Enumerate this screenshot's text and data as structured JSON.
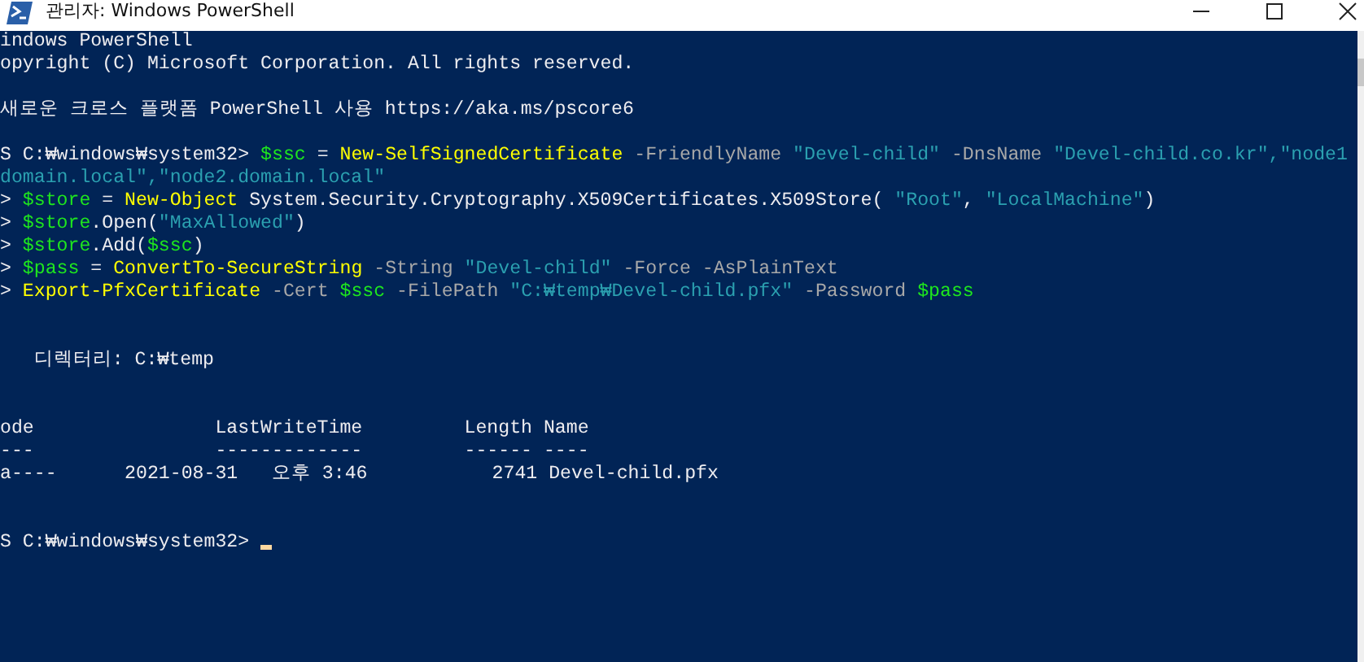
{
  "window": {
    "title": "관리자: Windows PowerShell"
  },
  "console": {
    "lines": [
      {
        "kind": "text",
        "segments": [
          {
            "kind": "plain",
            "text": "indows PowerShell"
          }
        ]
      },
      {
        "kind": "text",
        "segments": [
          {
            "kind": "plain",
            "text": "opyright (C) Microsoft Corporation. All rights reserved."
          }
        ]
      },
      {
        "kind": "blank"
      },
      {
        "kind": "text",
        "segments": [
          {
            "kind": "plain",
            "text": "새로운 크로스 플랫폼 PowerShell 사용 https://aka.ms/pscore6"
          }
        ]
      },
      {
        "kind": "blank"
      },
      {
        "kind": "text",
        "segments": [
          {
            "kind": "plain",
            "text": "S C:₩windows₩system32> "
          },
          {
            "kind": "variable",
            "text": "$ssc"
          },
          {
            "kind": "plain",
            "text": " = "
          },
          {
            "kind": "command",
            "text": "New-SelfSignedCertificate"
          },
          {
            "kind": "parameter",
            "text": " -FriendlyName"
          },
          {
            "kind": "string",
            "text": " \"Devel-child\""
          },
          {
            "kind": "parameter",
            "text": " -DnsName"
          },
          {
            "kind": "string",
            "text": " \"Devel-child.co.kr\",\"node1"
          }
        ]
      },
      {
        "kind": "text",
        "segments": [
          {
            "kind": "string",
            "text": "domain.local\",\"node2.domain.local\""
          }
        ]
      },
      {
        "kind": "text",
        "segments": [
          {
            "kind": "plain",
            "text": "> "
          },
          {
            "kind": "variable",
            "text": "$store"
          },
          {
            "kind": "plain",
            "text": " = "
          },
          {
            "kind": "command",
            "text": "New-Object"
          },
          {
            "kind": "plain",
            "text": " System.Security.Cryptography.X509Certificates.X509Store( "
          },
          {
            "kind": "string",
            "text": "\"Root\""
          },
          {
            "kind": "plain",
            "text": ", "
          },
          {
            "kind": "string",
            "text": "\"LocalMachine\""
          },
          {
            "kind": "plain",
            "text": ")"
          }
        ]
      },
      {
        "kind": "text",
        "segments": [
          {
            "kind": "plain",
            "text": "> "
          },
          {
            "kind": "variable",
            "text": "$store"
          },
          {
            "kind": "plain",
            "text": ".Open("
          },
          {
            "kind": "string",
            "text": "\"MaxAllowed\""
          },
          {
            "kind": "plain",
            "text": ")"
          }
        ]
      },
      {
        "kind": "text",
        "segments": [
          {
            "kind": "plain",
            "text": "> "
          },
          {
            "kind": "variable",
            "text": "$store"
          },
          {
            "kind": "plain",
            "text": ".Add("
          },
          {
            "kind": "variable",
            "text": "$ssc"
          },
          {
            "kind": "plain",
            "text": ")"
          }
        ]
      },
      {
        "kind": "text",
        "segments": [
          {
            "kind": "plain",
            "text": "> "
          },
          {
            "kind": "variable",
            "text": "$pass"
          },
          {
            "kind": "plain",
            "text": " = "
          },
          {
            "kind": "command",
            "text": "ConvertTo-SecureString"
          },
          {
            "kind": "parameter",
            "text": " -String"
          },
          {
            "kind": "string",
            "text": " \"Devel-child\""
          },
          {
            "kind": "parameter",
            "text": " -Force -AsPlainText"
          }
        ]
      },
      {
        "kind": "text",
        "segments": [
          {
            "kind": "plain",
            "text": "> "
          },
          {
            "kind": "command",
            "text": "Export-PfxCertificate"
          },
          {
            "kind": "parameter",
            "text": " -Cert"
          },
          {
            "kind": "variable",
            "text": " $ssc"
          },
          {
            "kind": "parameter",
            "text": " -FilePath"
          },
          {
            "kind": "string",
            "text": " \"C:₩temp₩Devel-child.pfx\""
          },
          {
            "kind": "parameter",
            "text": " -Password"
          },
          {
            "kind": "variable",
            "text": " $pass"
          }
        ]
      },
      {
        "kind": "blank"
      },
      {
        "kind": "blank"
      },
      {
        "kind": "text",
        "segments": [
          {
            "kind": "plain",
            "text": "   디렉터리: C:₩temp"
          }
        ]
      },
      {
        "kind": "blank"
      },
      {
        "kind": "blank"
      },
      {
        "kind": "text",
        "segments": [
          {
            "kind": "plain",
            "text": "ode                LastWriteTime         Length Name"
          }
        ]
      },
      {
        "kind": "text",
        "segments": [
          {
            "kind": "plain",
            "text": "---                -------------         ------ ----"
          }
        ]
      },
      {
        "kind": "text",
        "segments": [
          {
            "kind": "plain",
            "text": "a----      2021-08-31   오후 3:46           2741 Devel-child.pfx"
          }
        ]
      },
      {
        "kind": "blank"
      },
      {
        "kind": "blank"
      },
      {
        "kind": "prompt",
        "segments": [
          {
            "kind": "plain",
            "text": "S C:₩windows₩system32> "
          }
        ]
      }
    ]
  }
}
